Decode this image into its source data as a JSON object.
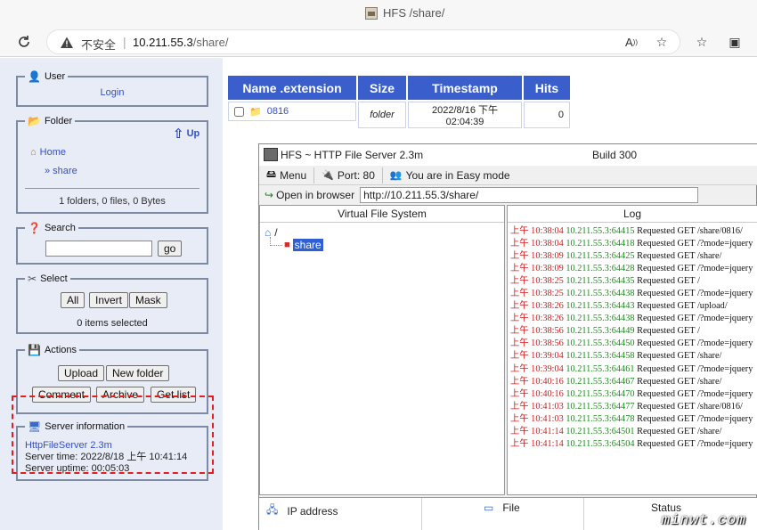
{
  "browser": {
    "tab_title": "HFS /share/",
    "insecure_label": "不安全",
    "url_host": "10.211.55.3",
    "url_path": "/share/"
  },
  "sidebar": {
    "user": {
      "legend": "User",
      "login": "Login"
    },
    "folder": {
      "legend": "Folder",
      "up": "Up",
      "home": "Home",
      "share": "» share",
      "summary": "1 folders, 0 files, 0 Bytes"
    },
    "search": {
      "legend": "Search",
      "go": "go",
      "value": ""
    },
    "select": {
      "legend": "Select",
      "all": "All",
      "invert": "Invert",
      "mask": "Mask",
      "count": "0 items selected"
    },
    "actions": {
      "legend": "Actions",
      "upload": "Upload",
      "new_folder": "New folder",
      "comment": "Comment",
      "archive": "Archive",
      "get_list": "Get list"
    },
    "server": {
      "legend": "Server information",
      "version": "HttpFileServer 2.3m",
      "time": "Server time: 2022/8/18 上午 10:41:14",
      "uptime": "Server uptime: 00:05:03"
    }
  },
  "file_table": {
    "headers": [
      "Name .extension",
      "Size",
      "Timestamp",
      "Hits"
    ],
    "rows": [
      {
        "name": "0816",
        "size": "folder",
        "timestamp": "2022/8/16 下午 02:04:39",
        "hits": "0"
      }
    ]
  },
  "hfs_app": {
    "title": "HFS ~ HTTP File Server 2.3m",
    "build": "Build 300",
    "menu": "Menu",
    "port": "Port: 80",
    "mode": "You are in Easy mode",
    "open_in_browser": "Open in browser",
    "url": "http://10.211.55.3/share/",
    "vfs_header": "Virtual File System",
    "vfs_root": "/",
    "vfs_share": "share",
    "log_header": "Log",
    "log": [
      {
        "ts": "上午 10:38:04",
        "ip": "10.211.55.3:64415",
        "msg": "Requested GET /share/0816/"
      },
      {
        "ts": "上午 10:38:04",
        "ip": "10.211.55.3:64418",
        "msg": "Requested GET /?mode=jquery"
      },
      {
        "ts": "上午 10:38:09",
        "ip": "10.211.55.3:64425",
        "msg": "Requested GET /share/"
      },
      {
        "ts": "上午 10:38:09",
        "ip": "10.211.55.3:64428",
        "msg": "Requested GET /?mode=jquery"
      },
      {
        "ts": "上午 10:38:25",
        "ip": "10.211.55.3:64435",
        "msg": "Requested GET /"
      },
      {
        "ts": "上午 10:38:25",
        "ip": "10.211.55.3:64438",
        "msg": "Requested GET /?mode=jquery"
      },
      {
        "ts": "上午 10:38:26",
        "ip": "10.211.55.3:64443",
        "msg": "Requested GET /upload/"
      },
      {
        "ts": "上午 10:38:26",
        "ip": "10.211.55.3:64438",
        "msg": "Requested GET /?mode=jquery"
      },
      {
        "ts": "上午 10:38:56",
        "ip": "10.211.55.3:64449",
        "msg": "Requested GET /"
      },
      {
        "ts": "上午 10:38:56",
        "ip": "10.211.55.3:64450",
        "msg": "Requested GET /?mode=jquery"
      },
      {
        "ts": "上午 10:39:04",
        "ip": "10.211.55.3:64458",
        "msg": "Requested GET /share/"
      },
      {
        "ts": "上午 10:39:04",
        "ip": "10.211.55.3:64461",
        "msg": "Requested GET /?mode=jquery"
      },
      {
        "ts": "上午 10:40:16",
        "ip": "10.211.55.3:64467",
        "msg": "Requested GET /share/"
      },
      {
        "ts": "上午 10:40:16",
        "ip": "10.211.55.3:64470",
        "msg": "Requested GET /?mode=jquery"
      },
      {
        "ts": "上午 10:41:03",
        "ip": "10.211.55.3:64477",
        "msg": "Requested GET /share/0816/"
      },
      {
        "ts": "上午 10:41:03",
        "ip": "10.211.55.3:64478",
        "msg": "Requested GET /?mode=jquery"
      },
      {
        "ts": "上午 10:41:14",
        "ip": "10.211.55.3:64501",
        "msg": "Requested GET /share/"
      },
      {
        "ts": "上午 10:41:14",
        "ip": "10.211.55.3:64504",
        "msg": "Requested GET /?mode=jquery"
      }
    ],
    "connections": {
      "ip": "IP address",
      "file": "File",
      "status": "Status"
    }
  },
  "watermark": "minwt.com"
}
